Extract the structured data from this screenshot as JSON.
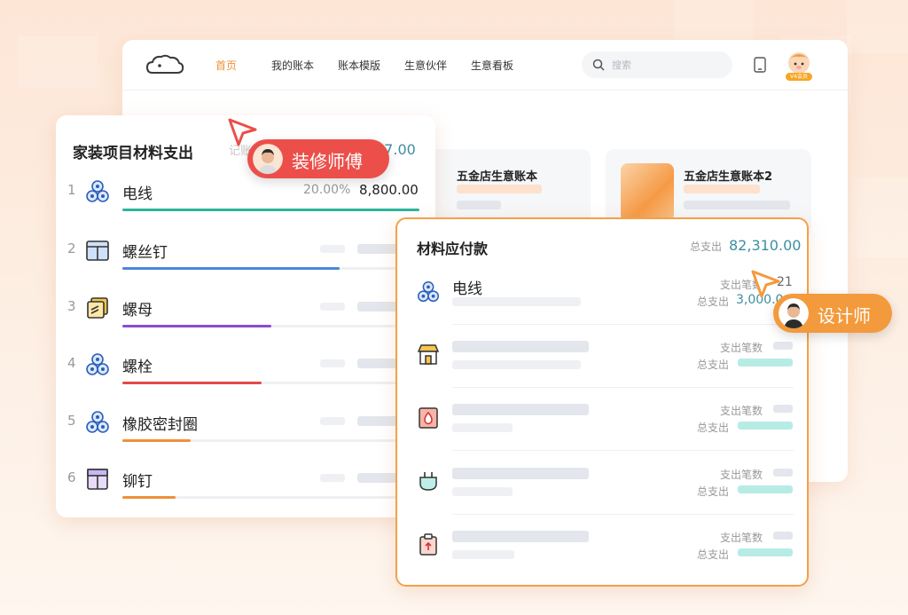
{
  "colors": {
    "accent": "#f0903a",
    "teal": "#3d8fa0",
    "red_tag": "#ec4f4a",
    "orange_tag": "#f39a3c"
  },
  "window": {
    "logo": "cloud-logo",
    "nav": [
      "首页",
      "我的账本",
      "账本模版",
      "生意伙伴",
      "生意看板"
    ],
    "active_nav": "首页",
    "search_placeholder": "搜索",
    "vip_badge": "V4会员"
  },
  "ledgers": [
    "五金店生意账本",
    "五金店生意账本2"
  ],
  "left_panel": {
    "title": "家装项目材料支出",
    "note": "记账",
    "total": "37.00",
    "items": [
      {
        "index": "1",
        "name": "电线",
        "icon": "reel-icon",
        "color": "#2bb59c",
        "share": 1.0,
        "percent": "20.00%",
        "amount": "8,800.00"
      },
      {
        "index": "2",
        "name": "螺丝钉",
        "icon": "toolbox-icon",
        "color": "#4a86dc",
        "share": 0.73
      },
      {
        "index": "3",
        "name": "螺母",
        "icon": "notes-icon",
        "color": "#8a4bd6",
        "share": 0.5
      },
      {
        "index": "4",
        "name": "螺栓",
        "icon": "reel-icon",
        "color": "#e24a4a",
        "share": 0.47
      },
      {
        "index": "5",
        "name": "橡胶密封圈",
        "icon": "reel-icon",
        "color": "#f0903a",
        "share": 0.23
      },
      {
        "index": "6",
        "name": "铆钉",
        "icon": "box-icon",
        "color": "#f0903a",
        "share": 0.18
      }
    ]
  },
  "right_panel": {
    "title": "材料应付款",
    "total_label": "总支出",
    "total": "82,310.00",
    "count_label": "支出笔数",
    "sum_label": "总支出",
    "rows": [
      {
        "name": "电线",
        "icon": "reel-icon",
        "count": "21",
        "sum": "3,000.0"
      },
      {
        "name": "",
        "icon": "shop-icon"
      },
      {
        "name": "",
        "icon": "drop-icon"
      },
      {
        "name": "",
        "icon": "plug-icon"
      },
      {
        "name": "",
        "icon": "clipboard-icon"
      }
    ]
  },
  "tags": {
    "decorator": "装修师傅",
    "designer": "设计师"
  }
}
